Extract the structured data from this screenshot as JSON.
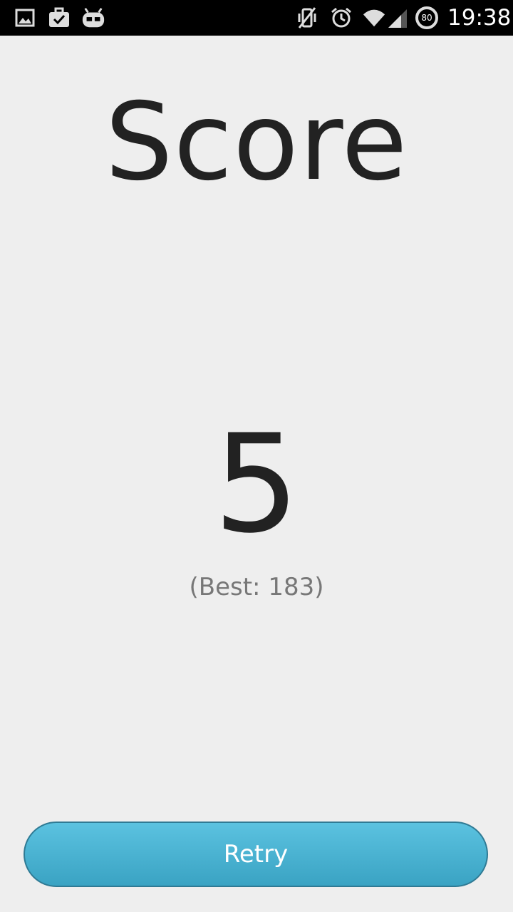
{
  "status_bar": {
    "left_icons": [
      "gallery-icon",
      "briefcase-check-icon",
      "android-robot-icon"
    ],
    "right_icons": [
      "vibrate-off-icon",
      "alarm-icon",
      "wifi-icon",
      "signal-icon",
      "battery-icon"
    ],
    "battery_level": "80",
    "time": "19:38"
  },
  "game_over": {
    "title": "Score",
    "score": "5",
    "best": "(Best: 183)"
  },
  "retry_button": {
    "label": "Retry"
  },
  "colors": {
    "background": "#eeeeee",
    "text_primary": "#222222",
    "text_secondary": "#777777",
    "button_top": "#5bc2e0",
    "button_bottom": "#3aa3c3",
    "button_border": "#2f7a94"
  }
}
